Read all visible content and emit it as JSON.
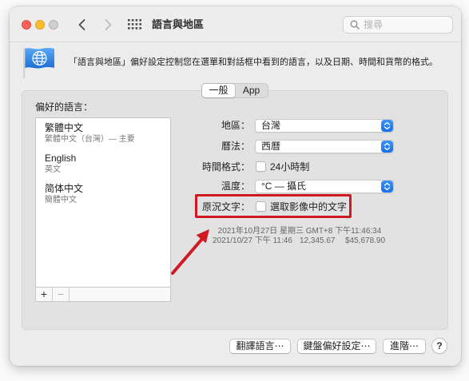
{
  "window": {
    "title": "語言與地區",
    "search_placeholder": "搜尋"
  },
  "header": {
    "description": "「語言與地區」偏好設定控制您在選單和對話框中看到的語言，以及日期、時間和貨幣的格式。"
  },
  "tabs": [
    {
      "label": "一般",
      "selected": true
    },
    {
      "label": "App",
      "selected": false
    }
  ],
  "preferred_languages": {
    "label": "偏好的語言：",
    "items": [
      {
        "name": "繁體中文",
        "detail": "繁體中文（台灣）— 主要"
      },
      {
        "name": "English",
        "detail": "英文"
      },
      {
        "name": "简体中文",
        "detail": "簡體中文"
      }
    ],
    "add_label": "+",
    "remove_label": "−"
  },
  "settings": {
    "region": {
      "label": "地區：",
      "value": "台灣"
    },
    "calendar": {
      "label": "曆法：",
      "value": "西曆"
    },
    "time_format": {
      "label": "時間格式：",
      "option": "24小時制",
      "checked": false
    },
    "temperature": {
      "label": "溫度：",
      "value": "°C — 攝氏"
    },
    "live_text": {
      "label": "原況文字：",
      "option": "選取影像中的文字",
      "checked": false
    }
  },
  "format_preview": {
    "long_date": "2021年10月27日 星期三 GMT+8 下午11:46:34",
    "short_date": "2021/10/27 下午 11:46",
    "number": "12,345.67",
    "currency": "$45,678.90"
  },
  "footer": {
    "translate_button": "翻譯語言⋯",
    "keyboard_button": "鍵盤偏好設定⋯",
    "advanced_button": "進階⋯",
    "help_button": "?"
  },
  "colors": {
    "close": "#fe5f57",
    "minimize": "#febc2e",
    "zoom_inactive": "#d0d0d0",
    "accent": "#1f7cf0",
    "annotation": "#cf1a22"
  },
  "icons": {
    "back": "chevron-left-icon",
    "forward": "chevron-right-icon",
    "show_all": "grid-icon",
    "search": "search-icon",
    "pane": "globe-flag-icon",
    "popup": "up-down-chevron-icon",
    "help": "question-mark-icon"
  }
}
